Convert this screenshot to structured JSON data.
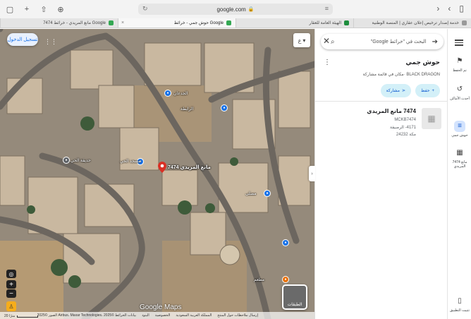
{
  "browser": {
    "url": "google.com",
    "tabs": [
      {
        "title": "7474 مانع المريدي - خرائط Google",
        "active": false
      },
      {
        "title": "حوش جمي - خرائط Google",
        "active": true
      },
      {
        "title": "الهيئة العامة للعقار",
        "active": false
      },
      {
        "title": "خدمة إصدار ترخيص إعلان عقاري | المنصة الوطنية",
        "active": false
      }
    ]
  },
  "map": {
    "signin_label": "تسجيل الدخول",
    "pin_label": "7474 مانع المريدي",
    "labels": [
      "الجدعان",
      "الرابطة",
      "حديقة الحي",
      "مسجد الحي",
      "مصلى",
      "مطعم"
    ],
    "layers_label": "الطبقات",
    "google_logo": "Google Maps",
    "footer": [
      "الصور ©2025 Airbus، Maxar Technologies، بيانات الخرائط ©2025",
      "البنود",
      "الخصوصية",
      "المملكة العربية السعودية",
      "إرسال ملاحظات حول المنتج"
    ],
    "scale": "20 مترًا"
  },
  "panel": {
    "search_placeholder": "البحث في \"خرائط Google\"",
    "title": "حوش جمي",
    "subtitle": "BLACK DRAGON ·مكان في قائمة مشاركة",
    "save_label": "حفظ",
    "share_label": "مشاركة",
    "result": {
      "name": "7474 مانع المريدي",
      "code": "MCKB7474",
      "address": "4171- الرصيفة",
      "city": "مكة 24232"
    }
  },
  "rail": {
    "saved": "تم الحفظ",
    "recents": "أحدث الأماكن",
    "current": "حوش جمي",
    "other": "7474 مانع المريدي",
    "install": "تثبيت التطبيق"
  },
  "colors": {
    "accent": "#0b57d0",
    "chip_bg": "#d3f0f8",
    "pin": "#d93025"
  }
}
